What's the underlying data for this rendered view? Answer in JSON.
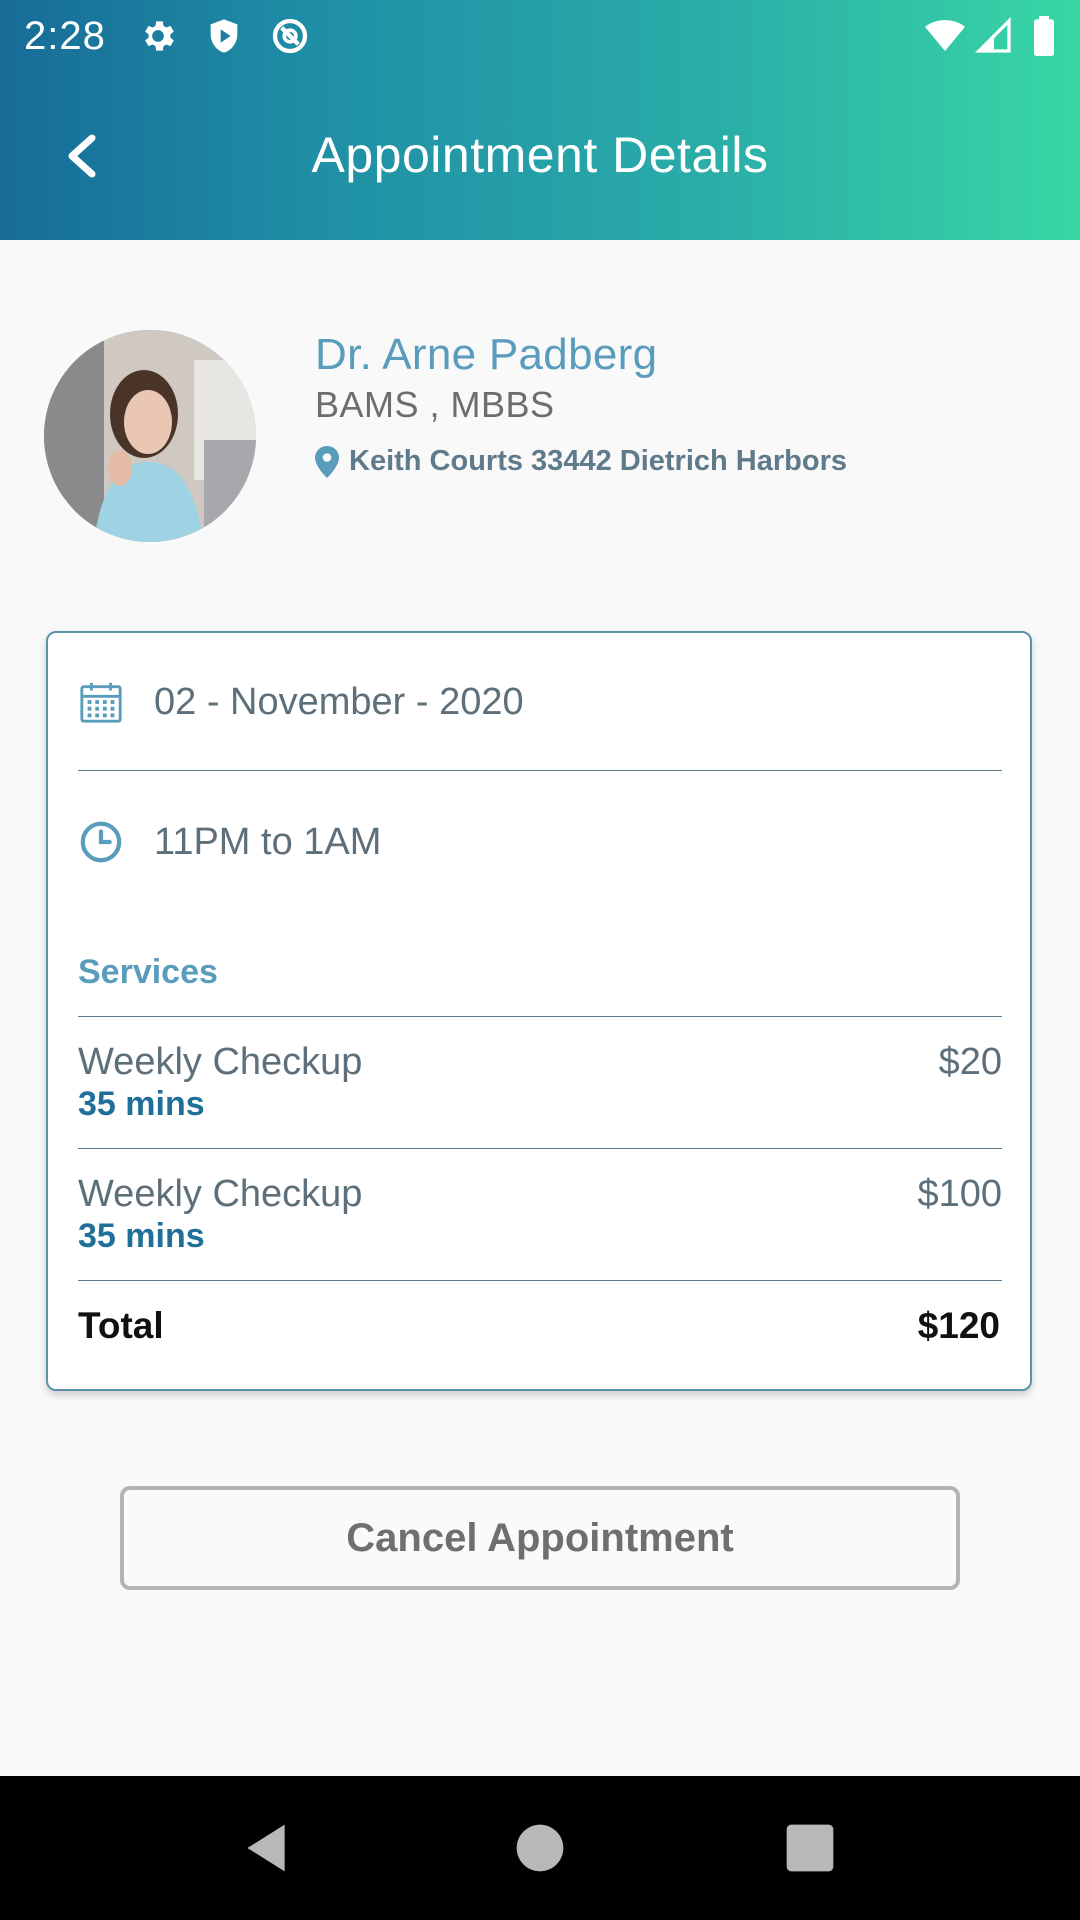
{
  "status_bar": {
    "time": "2:28",
    "icons": [
      "gear-icon",
      "shield-play-icon",
      "vpn-icon",
      "wifi-icon",
      "signal-icon",
      "battery-icon"
    ]
  },
  "header": {
    "title": "Appointment Details",
    "back_icon": "chevron-left-icon",
    "gradient_start": "#176c98",
    "gradient_end": "#38d6a5"
  },
  "doctor": {
    "name": "Dr. Arne Padberg",
    "degree": "BAMS , MBBS",
    "address": "Keith Courts 33442 Dietrich Harbors",
    "address_icon": "location-pin-icon"
  },
  "appointment": {
    "date": "02 - November - 2020",
    "date_icon": "calendar-icon",
    "time": "11PM to 1AM",
    "time_icon": "clock-icon"
  },
  "services": {
    "label": "Services",
    "items": [
      {
        "name": "Weekly Checkup",
        "duration": "35 mins",
        "price": "$20"
      },
      {
        "name": "Weekly Checkup",
        "duration": "35 mins",
        "price": "$100"
      }
    ],
    "total_label": "Total",
    "total_value": "$120"
  },
  "actions": {
    "cancel_label": "Cancel Appointment"
  },
  "colors": {
    "accent": "#5a9cbc",
    "duration": "#1f6f98",
    "text_muted": "#5d6f7a"
  }
}
